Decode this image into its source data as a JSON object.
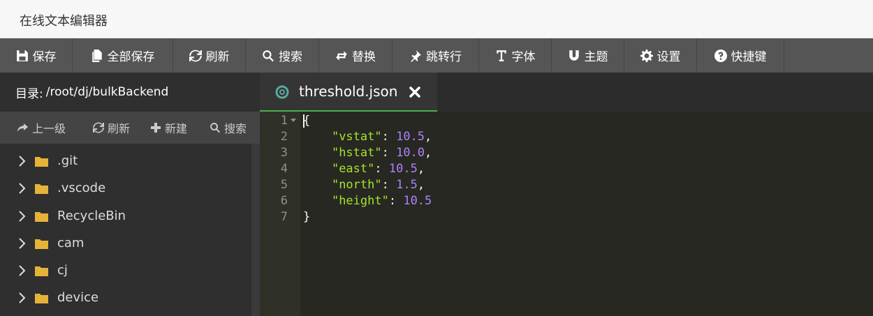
{
  "app": {
    "title": "在线文本编辑器"
  },
  "toolbar": {
    "buttons": [
      {
        "label": "保存",
        "icon": "save-icon"
      },
      {
        "label": "全部保存",
        "icon": "files-icon"
      },
      {
        "label": "刷新",
        "icon": "refresh-icon"
      },
      {
        "label": "搜索",
        "icon": "search-icon"
      },
      {
        "label": "替换",
        "icon": "replace-icon"
      },
      {
        "label": "跳转行",
        "icon": "pin-icon"
      },
      {
        "label": "字体",
        "icon": "text-icon"
      },
      {
        "label": "主题",
        "icon": "magnet-icon"
      },
      {
        "label": "设置",
        "icon": "gear-icon"
      },
      {
        "label": "快捷键",
        "icon": "help-icon"
      }
    ]
  },
  "sidebar": {
    "dir_label": "目录:",
    "dir_path": "/root/dj/bulkBackend",
    "tools": [
      {
        "label": "上一级",
        "icon": "share-icon"
      },
      {
        "label": "刷新",
        "icon": "refresh-icon"
      },
      {
        "label": "新建",
        "icon": "plus-icon"
      },
      {
        "label": "搜索",
        "icon": "search-icon"
      }
    ],
    "files": [
      ".git",
      ".vscode",
      "RecycleBin",
      "cam",
      "cj",
      "device"
    ]
  },
  "editor": {
    "tab_name": "threshold.json",
    "line_numbers": [
      "1",
      "2",
      "3",
      "4",
      "5",
      "6",
      "7"
    ],
    "code": {
      "open": "{",
      "close": "}",
      "entries": [
        {
          "key": "\"vstat\"",
          "value": "10.5",
          "trail": ","
        },
        {
          "key": "\"hstat\"",
          "value": "10.0",
          "trail": ","
        },
        {
          "key": "\"east\"",
          "value": "10.5",
          "trail": ","
        },
        {
          "key": "\"north\"",
          "value": "1.5",
          "trail": ","
        },
        {
          "key": "\"height\"",
          "value": "10.5",
          "trail": ""
        }
      ]
    }
  },
  "colors": {
    "toolbar_bg": "#555555",
    "sidebar_bg": "#2f2f2f",
    "editor_bg": "#272822",
    "tab_accent": "#4caf50",
    "string": "#a6e22e",
    "number": "#ae81ff",
    "folder": "#e6b339"
  }
}
